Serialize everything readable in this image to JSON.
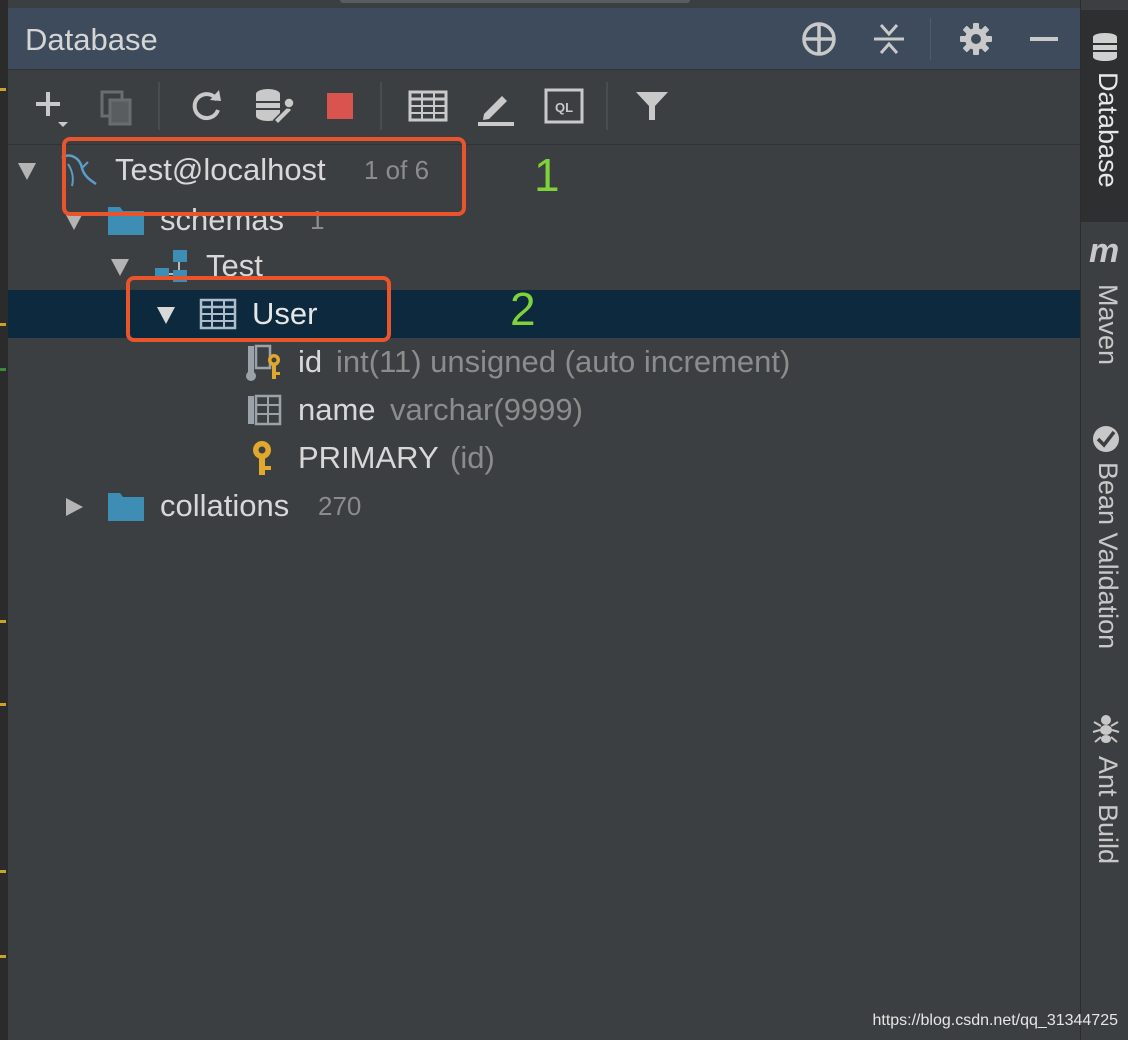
{
  "panel": {
    "title": "Database"
  },
  "tree": {
    "connection": {
      "name": "Test@localhost",
      "count": "1 of 6"
    },
    "schemas": {
      "name": "schemas",
      "count": "1"
    },
    "schema": {
      "name": "Test"
    },
    "table": {
      "name": "User"
    },
    "columns": [
      {
        "name": "id",
        "type": "int(11) unsigned (auto increment)"
      },
      {
        "name": "name",
        "type": "varchar(9999)"
      }
    ],
    "key": {
      "name": "PRIMARY",
      "cols": "(id)"
    },
    "collations": {
      "name": "collations",
      "count": "270"
    }
  },
  "annotations": [
    "1",
    "2"
  ],
  "right_tabs": [
    "Database",
    "Maven",
    "Bean Validation",
    "Ant Build"
  ],
  "right_tab_glyphs": {
    "maven": "m"
  },
  "watermark": "https://blog.csdn.net/qq_31344725",
  "colors": {
    "selection": "#0d293e",
    "folder": "#3d8db5",
    "key": "#e0a82e",
    "annotation_box": "#e8542c",
    "annotation_number": "#7fd33a",
    "stop": "#d9534f"
  },
  "icons": {
    "header": [
      "target-icon",
      "collapse-all-icon",
      "gear-icon",
      "minimize-icon"
    ],
    "toolbar": [
      "add-icon",
      "duplicate-icon",
      "refresh-icon",
      "db-properties-icon",
      "stop-icon",
      "table-editor-icon",
      "edit-icon",
      "console-icon",
      "filter-icon"
    ]
  }
}
